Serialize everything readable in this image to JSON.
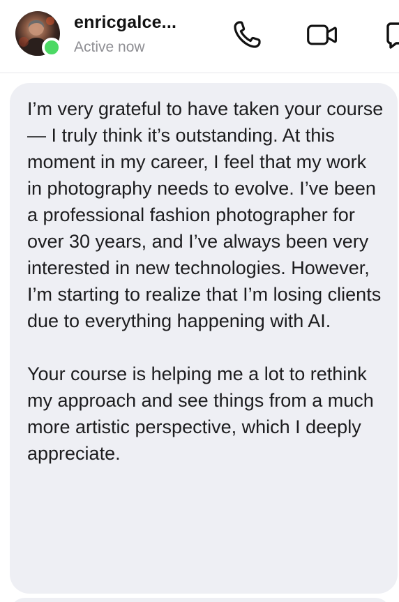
{
  "header": {
    "contact_name": "enricgalce...",
    "status": "Active now",
    "presence_color": "#4cd964",
    "icons": [
      "phone-icon",
      "video-camera-icon",
      "info-icon"
    ]
  },
  "message": {
    "paragraphs": [
      "I’m very grateful to have taken your course — I truly think it’s outstanding. At this moment in my career, I feel that my work in photography needs to evolve. I’ve been a professional fashion photographer for over 30 years, and I’ve always been very interested in new technologies. However, I’m starting to realize that I’m losing clients due to everything happening with AI.",
      "Your course is helping me a lot to rethink my approach and see things from a much more artistic perspective, which I deeply appreciate."
    ],
    "bubble_color": "#eeeff4"
  }
}
